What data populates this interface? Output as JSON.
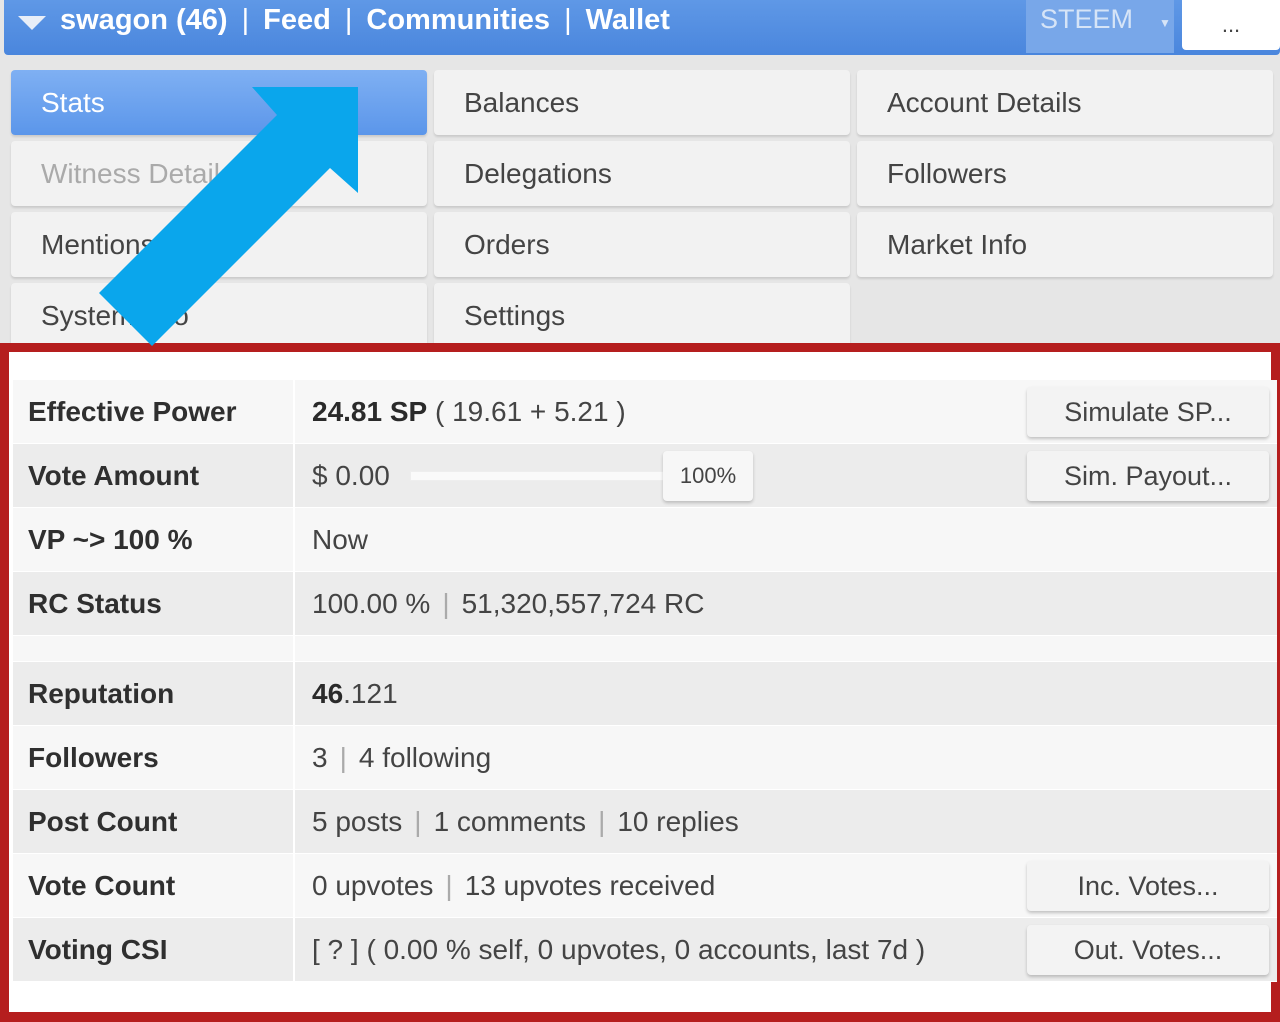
{
  "topbar": {
    "nav": [
      "swagon (46)",
      "Feed",
      "Communities",
      "Wallet"
    ],
    "separator": "|",
    "currency": "STEEM",
    "more": "..."
  },
  "menu": [
    {
      "label": "Stats",
      "state": "active"
    },
    {
      "label": "Balances",
      "state": "normal"
    },
    {
      "label": "Account Details",
      "state": "normal"
    },
    {
      "label": "Witness Details",
      "state": "disabled"
    },
    {
      "label": "Delegations",
      "state": "normal"
    },
    {
      "label": "Followers",
      "state": "normal"
    },
    {
      "label": "Mentions",
      "state": "normal"
    },
    {
      "label": "Orders",
      "state": "normal"
    },
    {
      "label": "Market Info",
      "state": "normal"
    },
    {
      "label": "System Info",
      "state": "normal"
    },
    {
      "label": "Settings",
      "state": "normal"
    }
  ],
  "stats": {
    "effective_power": {
      "label": "Effective Power",
      "sp": "24.81 SP",
      "detail": "( 19.61 + 5.21 )",
      "button": "Simulate SP..."
    },
    "vote_amount": {
      "label": "Vote Amount",
      "value": "$ 0.00",
      "percent": "100%",
      "button": "Sim. Payout..."
    },
    "vp": {
      "label": "VP ~> 100 %",
      "value": "Now"
    },
    "rc": {
      "label": "RC Status",
      "percent": "100.00 %",
      "amount": "51,320,557,724 RC"
    },
    "reputation": {
      "label": "Reputation",
      "whole": "46",
      "fraction": ".121"
    },
    "followers": {
      "label": "Followers",
      "count": "3",
      "following": "4 following"
    },
    "post_count": {
      "label": "Post Count",
      "posts": "5 posts",
      "comments": "1 comments",
      "replies": "10 replies"
    },
    "vote_count": {
      "label": "Vote Count",
      "upvotes": "0 upvotes",
      "received": "13 upvotes received",
      "button": "Inc. Votes..."
    },
    "voting_csi": {
      "label": "Voting CSI",
      "value": "[ ? ] ( 0.00 % self, 0 upvotes, 0 accounts, last 7d )",
      "button": "Out. Votes..."
    }
  },
  "colors": {
    "accent": "#4a86dd",
    "highlight_frame": "#b51e1e",
    "arrow": "#0aa6ec"
  }
}
